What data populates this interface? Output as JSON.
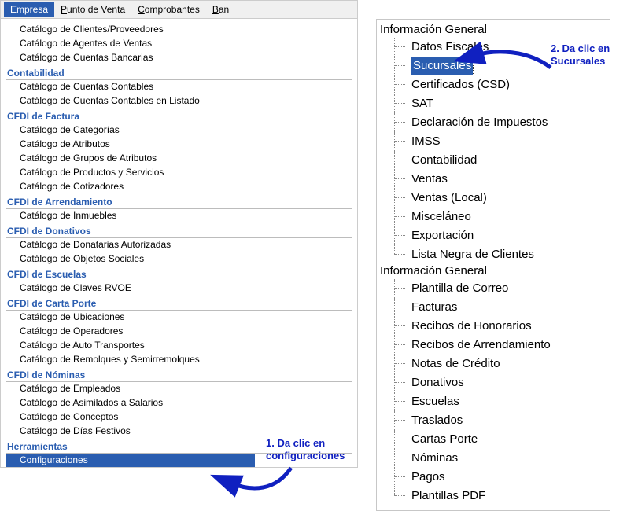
{
  "menubar": {
    "empresa": "Empresa",
    "punto_de_venta": "Punto de Venta",
    "comprobantes": "Comprobantes",
    "ban": "Ban"
  },
  "left": {
    "items": [
      {
        "t": "item",
        "label": "Catálogo de Clientes/Proveedores"
      },
      {
        "t": "item",
        "label": "Catálogo de Agentes de Ventas"
      },
      {
        "t": "item",
        "label": "Catálogo de Cuentas Bancarias"
      },
      {
        "t": "header",
        "label": "Contabilidad"
      },
      {
        "t": "item",
        "label": "Catálogo de Cuentas Contables"
      },
      {
        "t": "item",
        "label": "Catálogo de Cuentas Contables en Listado"
      },
      {
        "t": "header",
        "label": "CFDI de Factura"
      },
      {
        "t": "item",
        "label": "Catálogo de Categorías"
      },
      {
        "t": "item",
        "label": "Catálogo de Atributos"
      },
      {
        "t": "item",
        "label": "Catálogo de Grupos de Atributos"
      },
      {
        "t": "item",
        "label": "Catálogo de Productos y Servicios"
      },
      {
        "t": "item",
        "label": "Catálogo de Cotizadores"
      },
      {
        "t": "header",
        "label": "CFDI de Arrendamiento"
      },
      {
        "t": "item",
        "label": "Catálogo de Inmuebles"
      },
      {
        "t": "header",
        "label": "CFDI de Donativos"
      },
      {
        "t": "item",
        "label": "Catálogo de Donatarias Autorizadas"
      },
      {
        "t": "item",
        "label": "Catálogo de Objetos Sociales"
      },
      {
        "t": "header",
        "label": "CFDI de Escuelas"
      },
      {
        "t": "item",
        "label": "Catálogo de Claves RVOE"
      },
      {
        "t": "header",
        "label": "CFDI de Carta Porte"
      },
      {
        "t": "item",
        "label": "Catálogo de Ubicaciones"
      },
      {
        "t": "item",
        "label": "Catálogo de Operadores"
      },
      {
        "t": "item",
        "label": "Catálogo de Auto Transportes"
      },
      {
        "t": "item",
        "label": "Catálogo de Remolques y Semirremolques"
      },
      {
        "t": "header",
        "label": "CFDI de Nóminas"
      },
      {
        "t": "item",
        "label": "Catálogo de Empleados"
      },
      {
        "t": "item",
        "label": "Catálogo de Asimilados a Salarios"
      },
      {
        "t": "item",
        "label": "Catálogo de Conceptos"
      },
      {
        "t": "item",
        "label": "Catálogo de Días Festivos"
      },
      {
        "t": "header",
        "label": "Herramientas"
      },
      {
        "t": "item",
        "label": "Configuraciones",
        "selected": true
      }
    ]
  },
  "right": {
    "groups": [
      {
        "title": "Información General",
        "children": [
          {
            "label": "Datos Fiscales"
          },
          {
            "label": "Sucursales",
            "selected": true
          },
          {
            "label": "Certificados (CSD)"
          },
          {
            "label": "SAT"
          },
          {
            "label": "Declaración de Impuestos"
          },
          {
            "label": "IMSS"
          },
          {
            "label": "Contabilidad"
          },
          {
            "label": "Ventas"
          },
          {
            "label": "Ventas (Local)"
          },
          {
            "label": "Misceláneo"
          },
          {
            "label": "Exportación"
          },
          {
            "label": "Lista Negra de Clientes"
          }
        ]
      },
      {
        "title": "Información General",
        "children": [
          {
            "label": "Plantilla de Correo"
          },
          {
            "label": "Facturas"
          },
          {
            "label": "Recibos de Honorarios"
          },
          {
            "label": "Recibos de Arrendamiento"
          },
          {
            "label": "Notas de Crédito"
          },
          {
            "label": "Donativos"
          },
          {
            "label": "Escuelas"
          },
          {
            "label": "Traslados"
          },
          {
            "label": "Cartas Porte"
          },
          {
            "label": "Nóminas"
          },
          {
            "label": "Pagos"
          },
          {
            "label": "Plantillas PDF"
          }
        ]
      }
    ]
  },
  "annotations": {
    "a1_line1": "1. Da clic en",
    "a1_line2": "configuraciones",
    "a2_line1": "2. Da clic en",
    "a2_line2": "Sucursales"
  }
}
